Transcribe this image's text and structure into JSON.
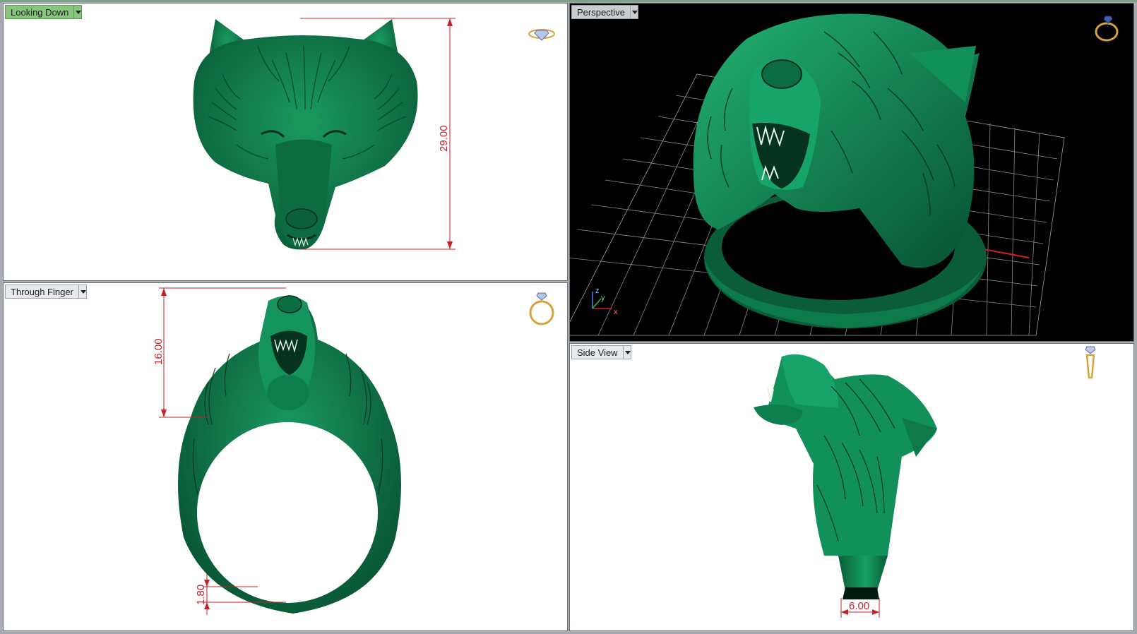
{
  "viewports": {
    "top": {
      "label": "Looking Down",
      "dimension": "29.00"
    },
    "perspective": {
      "label": "Perspective",
      "axis_x": "x",
      "axis_y": "y",
      "axis_z": "z"
    },
    "front": {
      "label": "Through Finger",
      "dimension_head": "16.00",
      "dimension_band": "1.80"
    },
    "side": {
      "label": "Side View",
      "dimension_width": "6.00"
    }
  },
  "colors": {
    "model": "#0f7a4b",
    "model_dark": "#07502f",
    "dimension": "#c2222a",
    "active_tab": "#88c57f",
    "grid": "#7a7a7a"
  },
  "icons": {
    "top": "ring-top-view-icon",
    "perspective": "ring-perspective-icon",
    "front": "ring-front-view-icon",
    "side": "ring-side-view-icon"
  }
}
